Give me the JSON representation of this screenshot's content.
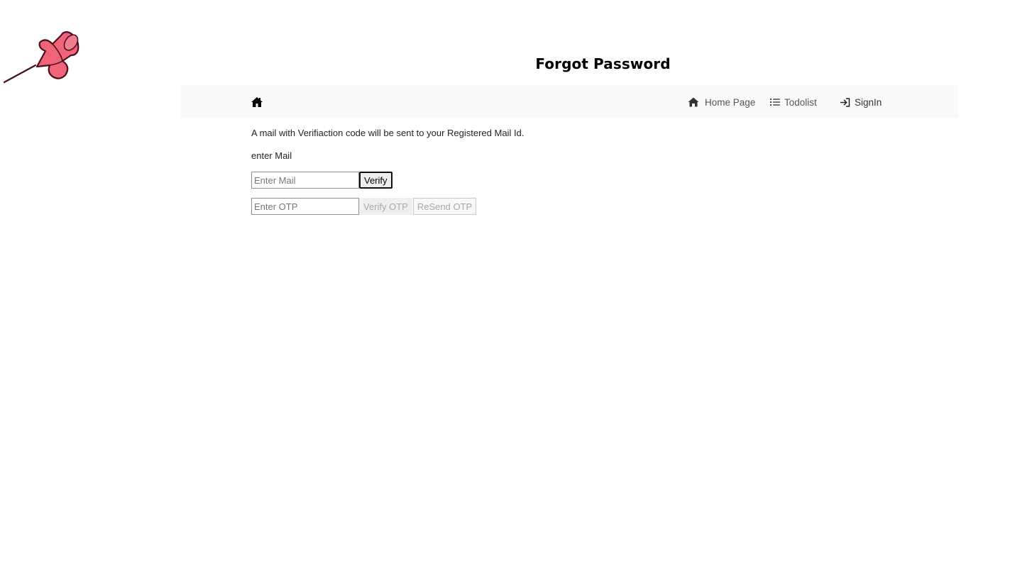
{
  "page": {
    "title": "Forgot Password"
  },
  "navbar": {
    "brand_icon": "home-icon",
    "items": [
      {
        "icon": "house-icon",
        "label": "Home Page"
      },
      {
        "icon": "list-icon",
        "label": "Todolist"
      },
      {
        "icon": "sign-in-icon",
        "label": "SignIn"
      }
    ]
  },
  "form": {
    "info": "A mail with Verifiaction code will be sent to your Registered Mail Id.",
    "mail_label": "enter Mail",
    "mail_input": {
      "value": "",
      "placeholder": "Enter Mail"
    },
    "verify_label": "Verify",
    "otp_input": {
      "value": "",
      "placeholder": "Enter OTP"
    },
    "verify_otp_label": "Verify OTP",
    "resend_otp_label": "ReSend OTP"
  },
  "colors": {
    "pin_fill": "#f0647a",
    "pin_outline": "#4a0f1e",
    "navbar_bg": "#f8f9fa"
  }
}
